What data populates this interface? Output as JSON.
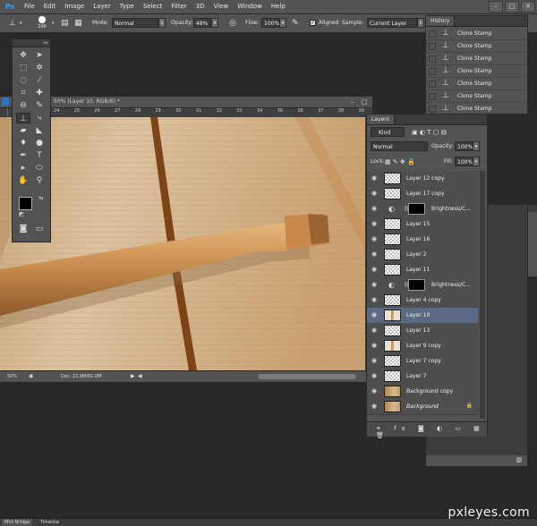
{
  "app": {
    "logo": "Ps"
  },
  "menu": [
    "File",
    "Edit",
    "Image",
    "Layer",
    "Type",
    "Select",
    "Filter",
    "3D",
    "View",
    "Window",
    "Help"
  ],
  "window_controls": [
    "–",
    "□",
    "✕"
  ],
  "options_bar": {
    "brush_size": "100",
    "mode_label": "Mode:",
    "mode_value": "Normal",
    "opacity_label": "Opacity:",
    "opacity_value": "48%",
    "flow_label": "Flow:",
    "flow_value": "100%",
    "aligned_label": "Aligned",
    "sample_label": "Sample:",
    "sample_value": "Current Layer"
  },
  "document": {
    "title": "50% (Layer 10, RGB/8) *",
    "ruler": [
      "24",
      "25",
      "26",
      "27",
      "28",
      "29",
      "30",
      "31",
      "32",
      "33",
      "34",
      "35",
      "36",
      "37",
      "38",
      "39"
    ],
    "zoom": "50%",
    "doc_size": "Doc: 22.9M/81.0M"
  },
  "history": {
    "tab": "History",
    "items": [
      "Clone Stamp",
      "Clone Stamp",
      "Clone Stamp",
      "Clone Stamp",
      "Clone Stamp",
      "Clone Stamp",
      "Clone Stamp"
    ]
  },
  "layers_panel": {
    "tab": "Layers",
    "kind": "Kind",
    "blend_mode": "Normal",
    "opacity_label": "Opacity:",
    "opacity_value": "100%",
    "lock_label": "Lock:",
    "fill_label": "Fill:",
    "fill_value": "100%",
    "layers": [
      {
        "name": "Layer 12 copy",
        "kind": "pixel"
      },
      {
        "name": "Layer 17 copy",
        "kind": "pixel"
      },
      {
        "name": "Brightness/C...",
        "kind": "adjustment"
      },
      {
        "name": "Layer 15",
        "kind": "pixel"
      },
      {
        "name": "Layer 16",
        "kind": "pixel"
      },
      {
        "name": "Layer 2",
        "kind": "pixel"
      },
      {
        "name": "Layer 11",
        "kind": "pixel"
      },
      {
        "name": "Brightness/C...",
        "kind": "adjustment"
      },
      {
        "name": "Layer 4 copy",
        "kind": "pixel"
      },
      {
        "name": "Layer 10",
        "kind": "pixel",
        "selected": true
      },
      {
        "name": "Layer 13",
        "kind": "pixel"
      },
      {
        "name": "Layer 9 copy",
        "kind": "pixel"
      },
      {
        "name": "Layer 7 copy",
        "kind": "pixel"
      },
      {
        "name": "Layer 7",
        "kind": "pixel"
      },
      {
        "name": "Background copy",
        "kind": "wood"
      },
      {
        "name": "Background",
        "kind": "wood",
        "italic": true,
        "locked": true
      }
    ]
  },
  "bottom_tabs": [
    "Mini Bridge",
    "Timeline"
  ],
  "watermark": "pxleyes.com",
  "colors": {
    "ui_panel": "#535353",
    "ui_dark": "#282828",
    "selection": "#5a6a82",
    "ps_blue": "#2fa3ff",
    "wood": "#d9b98a"
  }
}
